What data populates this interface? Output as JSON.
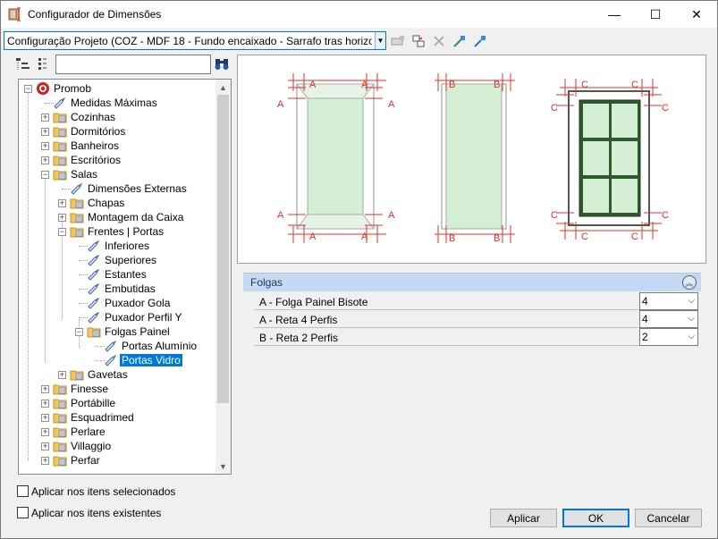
{
  "window": {
    "title": "Configurador de Dimensões",
    "min_glyph": "—",
    "max_glyph": "☐",
    "close_glyph": "✕"
  },
  "config_combo": {
    "value": "Configuração Projeto (COZ - MDF 18 - Fundo encaixado - Sarrafo tras horizon"
  },
  "toolbar_icons": [
    "add-config-icon",
    "edit-config-icon",
    "delete-icon",
    "import-icon",
    "export-icon"
  ],
  "search": {
    "value": ""
  },
  "tree": {
    "root": "Promob",
    "items": [
      {
        "label": "Medidas Máximas"
      },
      {
        "label": "Cozinhas"
      },
      {
        "label": "Dormitórios"
      },
      {
        "label": "Banheiros"
      },
      {
        "label": "Escritórios"
      },
      {
        "label": "Salas"
      },
      {
        "label": "Dimensões Externas"
      },
      {
        "label": "Chapas"
      },
      {
        "label": "Montagem da Caixa"
      },
      {
        "label": "Frentes | Portas"
      },
      {
        "label": "Inferiores"
      },
      {
        "label": "Superiores"
      },
      {
        "label": "Estantes"
      },
      {
        "label": "Embutidas"
      },
      {
        "label": "Puxador Gola"
      },
      {
        "label": "Puxador Perfil Y"
      },
      {
        "label": "Folgas Painel"
      },
      {
        "label": "Portas Alumínio"
      },
      {
        "label": "Portas Vidro"
      },
      {
        "label": "Gavetas"
      },
      {
        "label": "Finesse"
      },
      {
        "label": "Portábille"
      },
      {
        "label": "Esquadrimed"
      },
      {
        "label": "Perlare"
      },
      {
        "label": "Villaggio"
      },
      {
        "label": "Perfar"
      }
    ]
  },
  "checkboxes": {
    "apply_selected": "Aplicar nos itens selecionados",
    "apply_existing": "Aplicar nos itens existentes"
  },
  "preview": {
    "labels_a": "A",
    "labels_b": "B",
    "labels_c": "C",
    "colors": {
      "dim": "#e0302a",
      "panel": "#d4efd4",
      "glass_frame": "#2e5a2e",
      "frame": "#9a9a9a"
    }
  },
  "property_grid": {
    "group": "Folgas",
    "rows": [
      {
        "label": "A - Folga Painel Bisote",
        "value": "4"
      },
      {
        "label": "A - Reta 4 Perfis",
        "value": "4"
      },
      {
        "label": "B - Reta 2 Perfis",
        "value": "2"
      }
    ]
  },
  "buttons": {
    "apply": "Aplicar",
    "ok": "OK",
    "cancel": "Cancelar"
  }
}
